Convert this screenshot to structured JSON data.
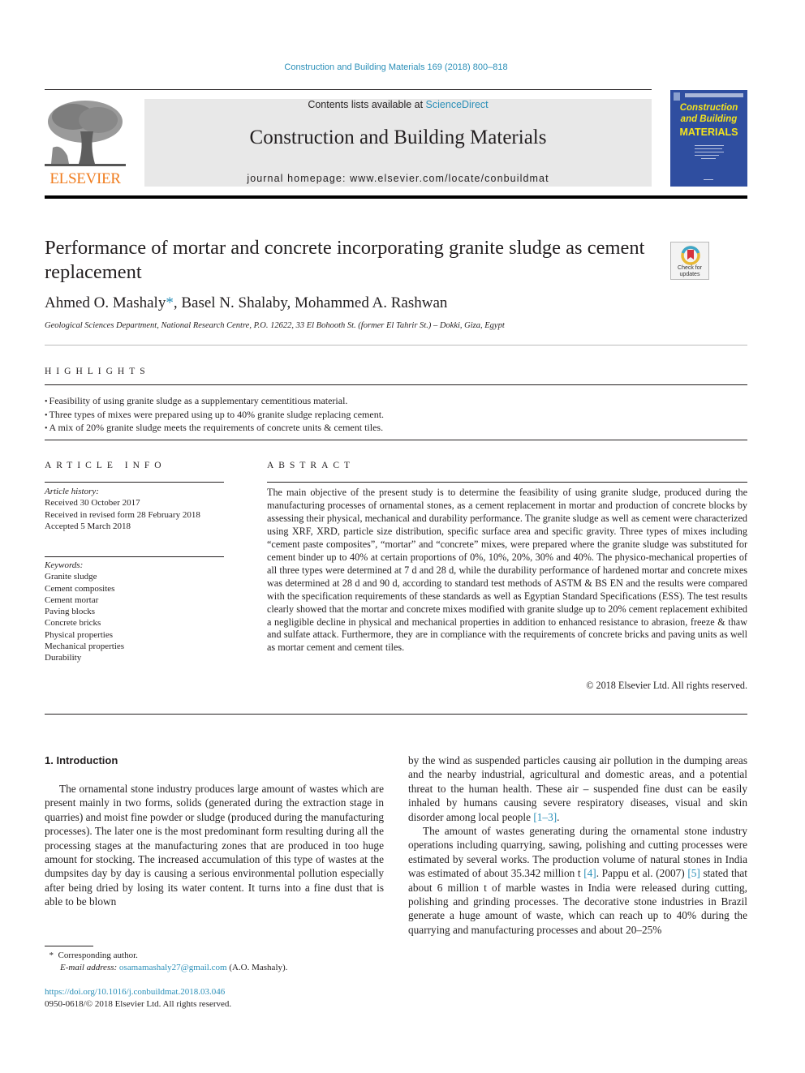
{
  "header": {
    "journal_reference": "Construction and Building Materials 169 (2018) 800–818",
    "contents_prefix": "Contents lists available at ",
    "contents_link": "ScienceDirect",
    "journal_title": "Construction and Building Materials",
    "homepage": "journal homepage: www.elsevier.com/locate/conbuildmat",
    "publisher_logo_text": "ELSEVIER",
    "cover": {
      "line1": "Construction",
      "line2": "and Building",
      "line3": "MATERIALS",
      "background": "#2f4ea0",
      "text_color": "#f4e31d"
    },
    "publisher_color": "#f07d1f",
    "link_color": "#2a8fb8"
  },
  "article": {
    "title": "Performance of mortar and concrete incorporating granite sludge as cement replacement",
    "check_updates_line1": "Check for",
    "check_updates_line2": "updates",
    "authors_text": "Ahmed O. Mashaly",
    "authors_star": "*",
    "authors_rest": ", Basel N. Shalaby, Mohammed A. Rashwan",
    "affiliation": "Geological Sciences Department, National Research Centre, P.O. 12622, 33 El Bohooth St. (former El Tahrir St.) – Dokki, Giza, Egypt"
  },
  "highlights": {
    "label": "HIGHLIGHTS",
    "items": [
      "Feasibility of using granite sludge as a supplementary cementitious material.",
      "Three types of mixes were prepared using up to 40% granite sludge replacing cement.",
      "A mix of 20% granite sludge meets the requirements of concrete units & cement tiles."
    ]
  },
  "article_info": {
    "label": "ARTICLE INFO",
    "history_label": "Article history:",
    "history": [
      "Received 30 October 2017",
      "Received in revised form 28 February 2018",
      "Accepted 5 March 2018"
    ],
    "keywords_label": "Keywords:",
    "keywords": [
      "Granite sludge",
      "Cement composites",
      "Cement mortar",
      "Paving blocks",
      "Concrete bricks",
      "Physical properties",
      "Mechanical properties",
      "Durability"
    ]
  },
  "abstract": {
    "label": "ABSTRACT",
    "text": "The main objective of the present study is to determine the feasibility of using granite sludge, produced during the manufacturing processes of ornamental stones, as a cement replacement in mortar and production of concrete blocks by assessing their physical, mechanical and durability performance. The granite sludge as well as cement were characterized using XRF, XRD, particle size distribution, specific surface area and specific gravity. Three types of mixes including “cement paste composites”, “mortar” and “concrete” mixes, were prepared where the granite sludge was substituted for cement binder up to 40% at certain proportions of 0%, 10%, 20%, 30% and 40%. The physico-mechanical properties of all three types were determined at 7 d and 28 d, while the durability performance of hardened mortar and concrete mixes was determined at 28 d and 90 d, according to standard test methods of ASTM & BS EN and the results were compared with the specification requirements of these standards as well as Egyptian Standard Specifications (ESS). The test results clearly showed that the mortar and concrete mixes modified with granite sludge up to 20% cement replacement exhibited a negligible decline in physical and mechanical properties in addition to enhanced resistance to abrasion, freeze & thaw and sulfate attack. Furthermore, they are in compliance with the requirements of concrete bricks and paving units as well as mortar cement and cement tiles.",
    "copyright": "© 2018 Elsevier Ltd. All rights reserved."
  },
  "body": {
    "section_heading": "1. Introduction",
    "left_para1": "The ornamental stone industry produces large amount of wastes which are present mainly in two forms, solids (generated during the extraction stage in quarries) and moist fine powder or sludge (produced during the manufacturing processes). The later one is the most predominant form resulting during all the processing stages at the manufacturing zones that are produced in too huge amount for stocking. The increased accumulation of this type of wastes at the dumpsites day by day is causing a serious environmental pollution especially after being dried by losing its water content. It turns into a fine dust that is able to be blown",
    "right_para1_text": "by the wind as suspended particles causing air pollution in the dumping areas and the nearby industrial, agricultural and domestic areas, and a potential threat to the human health. These air – suspended fine dust can be easily inhaled by humans causing severe respiratory diseases, visual and skin disorder among local people ",
    "right_para1_cite": "[1–3]",
    "right_para1_end": ".",
    "right_para2_a": "The amount of wastes generating during the ornamental stone industry operations including quarrying, sawing, polishing and cutting processes were estimated by several works. The production volume of natural stones in India was estimated of about 35.342 million t ",
    "right_para2_cite1": "[4]",
    "right_para2_b": ". Pappu et al. (2007) ",
    "right_para2_cite2": "[5]",
    "right_para2_c": " stated that about 6 million t of marble wastes in India were released during cutting, polishing and grinding processes. The decorative stone industries in Brazil generate a huge amount of waste, which can reach up to 40% during the quarrying and manufacturing processes and about 20–25%"
  },
  "footer": {
    "corresponding_mark": "*",
    "corresponding_text": "Corresponding author.",
    "email_label": "E-mail address:",
    "email": "osamamashaly27@gmail.com",
    "email_suffix": "(A.O. Mashaly).",
    "doi": "https://doi.org/10.1016/j.conbuildmat.2018.03.046",
    "issn_line": "0950-0618/© 2018 Elsevier Ltd. All rights reserved."
  }
}
